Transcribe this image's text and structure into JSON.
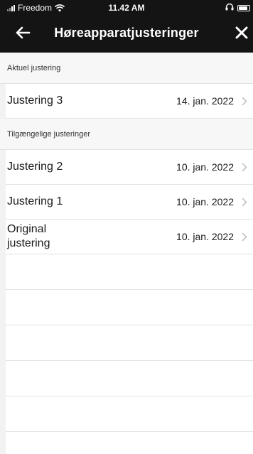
{
  "status_bar": {
    "carrier": "Freedom",
    "time": "11.42 AM",
    "signal_bars": 4,
    "signal_active": 2,
    "battery_level": 0.85
  },
  "nav": {
    "title": "Høreapparatjusteringer",
    "back_icon": "arrow-left-icon",
    "close_icon": "close-icon"
  },
  "current_section": {
    "header": "Aktuel justering",
    "items": [
      {
        "label": "Justering 3",
        "date": "14. jan. 2022"
      }
    ]
  },
  "available_section": {
    "header": "Tilgængelige justeringer",
    "items": [
      {
        "label": "Justering 2",
        "date": "10. jan. 2022"
      },
      {
        "label": "Justering 1",
        "date": "10. jan. 2022"
      },
      {
        "label": "Original justering",
        "date": "10. jan. 2022"
      }
    ]
  },
  "colors": {
    "header_bg": "#141414",
    "chevron": "#b8b8b8",
    "divider": "#e2e2e2"
  }
}
